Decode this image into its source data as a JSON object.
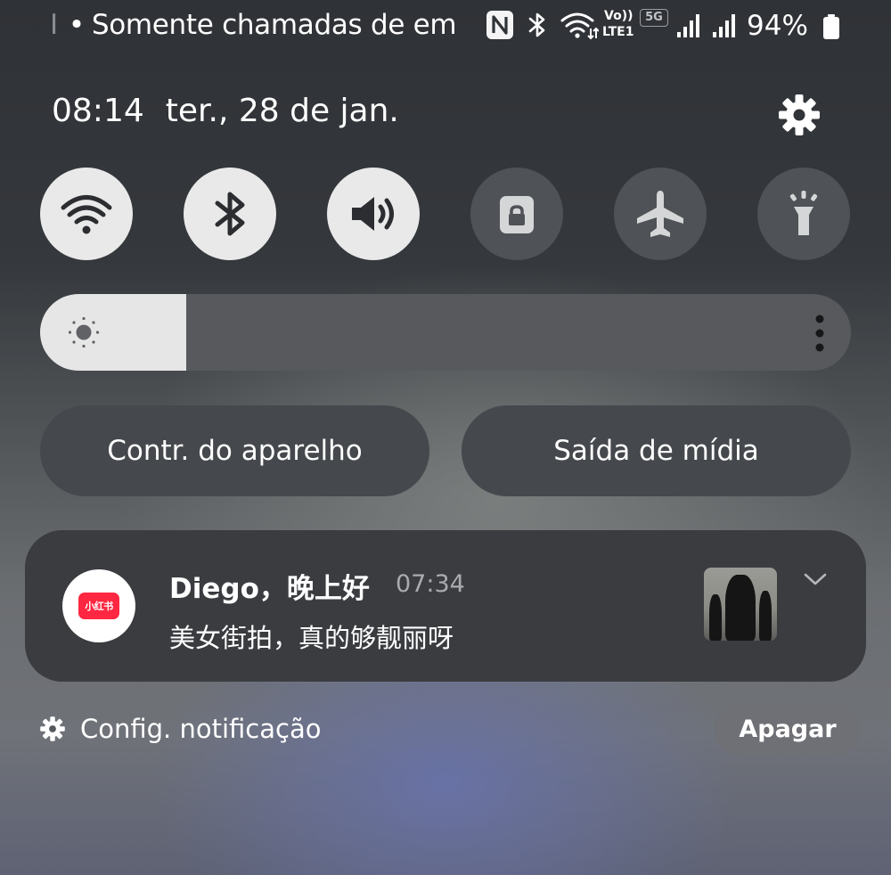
{
  "status_bar": {
    "separator": "I",
    "notification_text": "Somente chamadas de em",
    "volte_line1": "Vo))",
    "volte_line2": "LTE1",
    "network": "5G",
    "battery": "94%",
    "icons": [
      "nfc-icon",
      "bluetooth-icon",
      "wifi-icon",
      "volte-icon",
      "signal-icon",
      "signal-icon",
      "battery-icon"
    ]
  },
  "header": {
    "time": "08:14",
    "date": "ter., 28 de jan.",
    "settings_icon": "gear-icon"
  },
  "quick_toggles": [
    {
      "name": "wifi",
      "icon": "wifi-icon",
      "state": "on"
    },
    {
      "name": "bluetooth",
      "icon": "bluetooth-icon",
      "state": "on"
    },
    {
      "name": "sound",
      "icon": "speaker-icon",
      "state": "on"
    },
    {
      "name": "rotation-lock",
      "icon": "lock-icon",
      "state": "off"
    },
    {
      "name": "airplane-mode",
      "icon": "airplane-icon",
      "state": "off"
    },
    {
      "name": "flashlight",
      "icon": "flashlight-icon",
      "state": "off"
    }
  ],
  "brightness": {
    "level": 0.18,
    "icon": "sun-icon",
    "more_icon": "more-vertical-icon"
  },
  "buttons": {
    "device_control": "Contr. do aparelho",
    "media_output": "Saída de mídia"
  },
  "notification": {
    "app_badge": "小红书",
    "title": "Diego，晚上好",
    "time": "07:34",
    "body": "美女街拍，真的够靓丽呀"
  },
  "footer": {
    "notif_settings": "Config. notificação",
    "clear": "Apagar"
  },
  "colors": {
    "toggle_on": "#e9e9e9",
    "toggle_off": "#4f5256",
    "app_brand": "#ff2741",
    "card": "#3a3c40"
  }
}
